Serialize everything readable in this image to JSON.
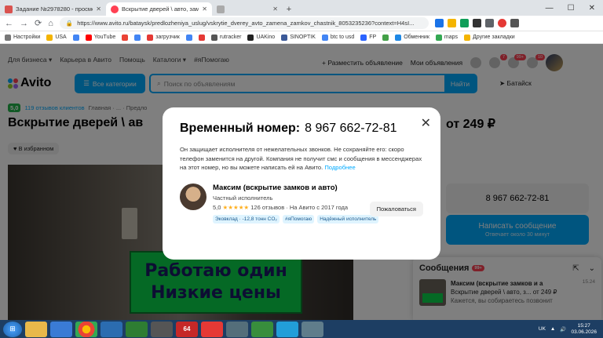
{
  "browser": {
    "tabs": [
      {
        "title": "Задание №2978280 - просмотр з",
        "close": "✕",
        "color": "#d9534f"
      },
      {
        "title": "Вскрытие дверей \\ авто, замена",
        "close": "✕",
        "color": "#ff4053"
      },
      {
        "title": "",
        "close": "✕",
        "color": "#aaaaaa"
      }
    ],
    "new_tab": "+",
    "url": "https://www.avito.ru/bataysk/predlozheniya_uslug/vskrytie_dverey_avto_zamena_zamkov_chastnik_8053235236?context=H4sI...",
    "window_controls": [
      "—",
      "☐",
      "✕"
    ],
    "nav": [
      "←",
      "→",
      "⟳",
      "⌂"
    ],
    "bookmarks": [
      "Настройки",
      "USA",
      "",
      "YouTube",
      "",
      "",
      "загрузчик",
      "",
      "",
      "rutracker",
      "UAKino",
      "SINOPTIK",
      "btc to usd",
      "FP",
      "",
      "Обменник",
      "maps",
      "Другие закладки"
    ]
  },
  "site": {
    "topnav": [
      "Для бизнеса ▾",
      "Карьера в Авито",
      "Помощь",
      "Каталоги ▾",
      "#яПомогаю"
    ],
    "post_ad": "+ Разместить объявление",
    "my_ads": "Мои объявления",
    "badges": {
      "messages": "7",
      "notif": "99+",
      "cart": "10"
    },
    "logo": "Avito",
    "categories_btn": "Все категории",
    "search_placeholder": "Поиск по объявлениям",
    "search_btn": "Найти",
    "location": "Батайск",
    "rating_score": "5,0",
    "rating_reviews": "119 отзывов клиентов",
    "breadcrumb": "Главная · ... · Предло",
    "title": "Вскрытие дверей \\ ав",
    "price": "от 249 ₽",
    "favorite": "♥ В избранном",
    "sign_lines": [
      "Работаю один",
      "Низкие цены"
    ],
    "phone": "8 967 662-72-81",
    "write_btn": "Написать сообщение",
    "write_sub": "Отвечает около 30 минут",
    "chat": {
      "title": "Сообщения",
      "count": "99+",
      "item_name": "Максим (вскрытие замков и а",
      "item_line2": "Вскрытие дверей \\ авто, з... от 249 ₽",
      "item_line3": "Кажется, вы собираетесь позвонит",
      "item_time": "15.24"
    }
  },
  "modal": {
    "title": "Временный номер:",
    "number": "8 967 662-72-81",
    "desc": "Он защищает исполнителя от нежелательных звонков. Не сохраняйте его: скоро телефон заменится на другой. Компания не получит смс и сообщения в мессенджерах на этот номер, но вы можете написать ей на Авито.",
    "more": "Подробнее",
    "seller_name": "Максим (вскрытие замков и авто)",
    "seller_type": "Частный исполнитель",
    "seller_score": "5,0",
    "seller_stars": "★★★★★",
    "seller_reviews": "126 отзывов · На Авито с 2017 года",
    "tags": [
      "Эковклад · -12,8 тонн CO₂",
      "#яПомогаю",
      "Надёжный исполнитель"
    ],
    "complain": "Пожаловаться",
    "close": "✕"
  },
  "taskbar": {
    "lang": "UK",
    "time": "15:27",
    "date": "03.06.2026",
    "apps": [
      "",
      "",
      "",
      "",
      "",
      "",
      "64",
      "",
      "",
      "",
      "",
      ""
    ]
  }
}
